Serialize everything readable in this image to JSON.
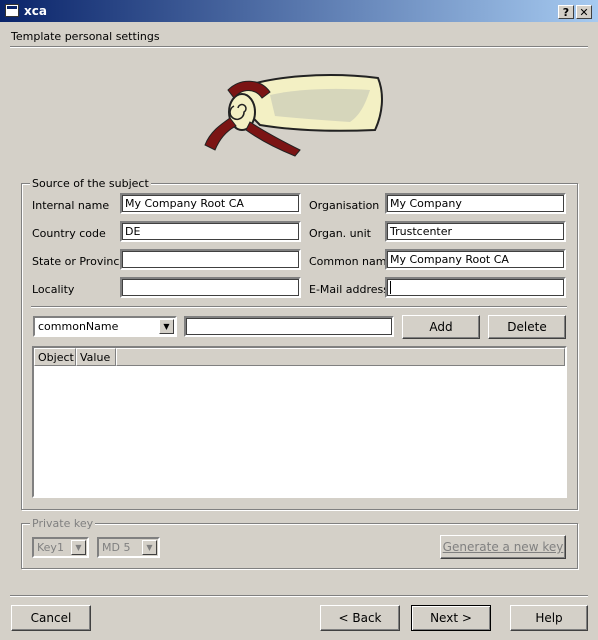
{
  "window": {
    "title": "xca",
    "help_glyph": "?",
    "close_glyph": "✕"
  },
  "page": {
    "title": "Template personal settings"
  },
  "subject": {
    "group_title": "Source of the subject",
    "internal_name": {
      "label": "Internal name",
      "value": "My Company Root CA"
    },
    "country_code": {
      "label": "Country code",
      "value": "DE"
    },
    "state": {
      "label": "State or Province",
      "value": ""
    },
    "locality": {
      "label": "Locality",
      "value": ""
    },
    "organisation": {
      "label": "Organisation",
      "value": "My Company"
    },
    "org_unit": {
      "label": "Organ. unit",
      "value": "Trustcenter"
    },
    "common_name": {
      "label": "Common name",
      "value": "My Company Root CA"
    },
    "email": {
      "label": "E-Mail address",
      "value": ""
    },
    "type_select": "commonName",
    "value_input": "",
    "add_label": "Add",
    "delete_label": "Delete",
    "columns": [
      "Object",
      "Value"
    ]
  },
  "private_key": {
    "group_title": "Private key",
    "key_select": "Key1",
    "hash_select": "MD 5",
    "generate_label": "Generate a new key"
  },
  "footer": {
    "cancel": "Cancel",
    "back": "< Back",
    "next": "Next >",
    "help": "Help"
  },
  "colors": {
    "titlebar": "#0a246a",
    "face": "#d4d0c8"
  }
}
